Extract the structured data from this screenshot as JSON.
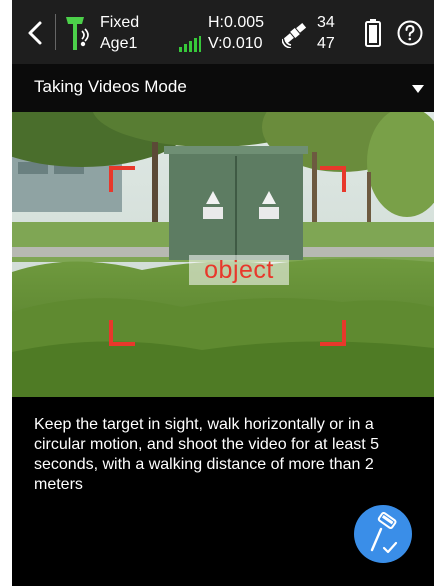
{
  "status": {
    "fix": "Fixed",
    "age": "Age1",
    "h_accuracy": "H:0.005",
    "v_accuracy": "V:0.010",
    "satellites_used": "34",
    "satellites_total": "47"
  },
  "mode": {
    "title": "Taking Videos Mode"
  },
  "camera": {
    "target_label": "object"
  },
  "instruction": "Keep the target in sight, walk horizontally or in a circular motion, and shoot the video for at least 5 seconds, with a walking distance of more than 2 meters",
  "colors": {
    "accent_blue": "#3a8ee8",
    "frame_red": "#e8382b",
    "signal_green": "#37c83a",
    "gnss_green": "#4cd04a"
  },
  "icons": [
    "back-icon",
    "gnss-receiver-icon",
    "signal-strength-icon",
    "satellite-icon",
    "battery-icon",
    "help-icon",
    "dropdown-caret-icon",
    "survey-pole-icon"
  ]
}
